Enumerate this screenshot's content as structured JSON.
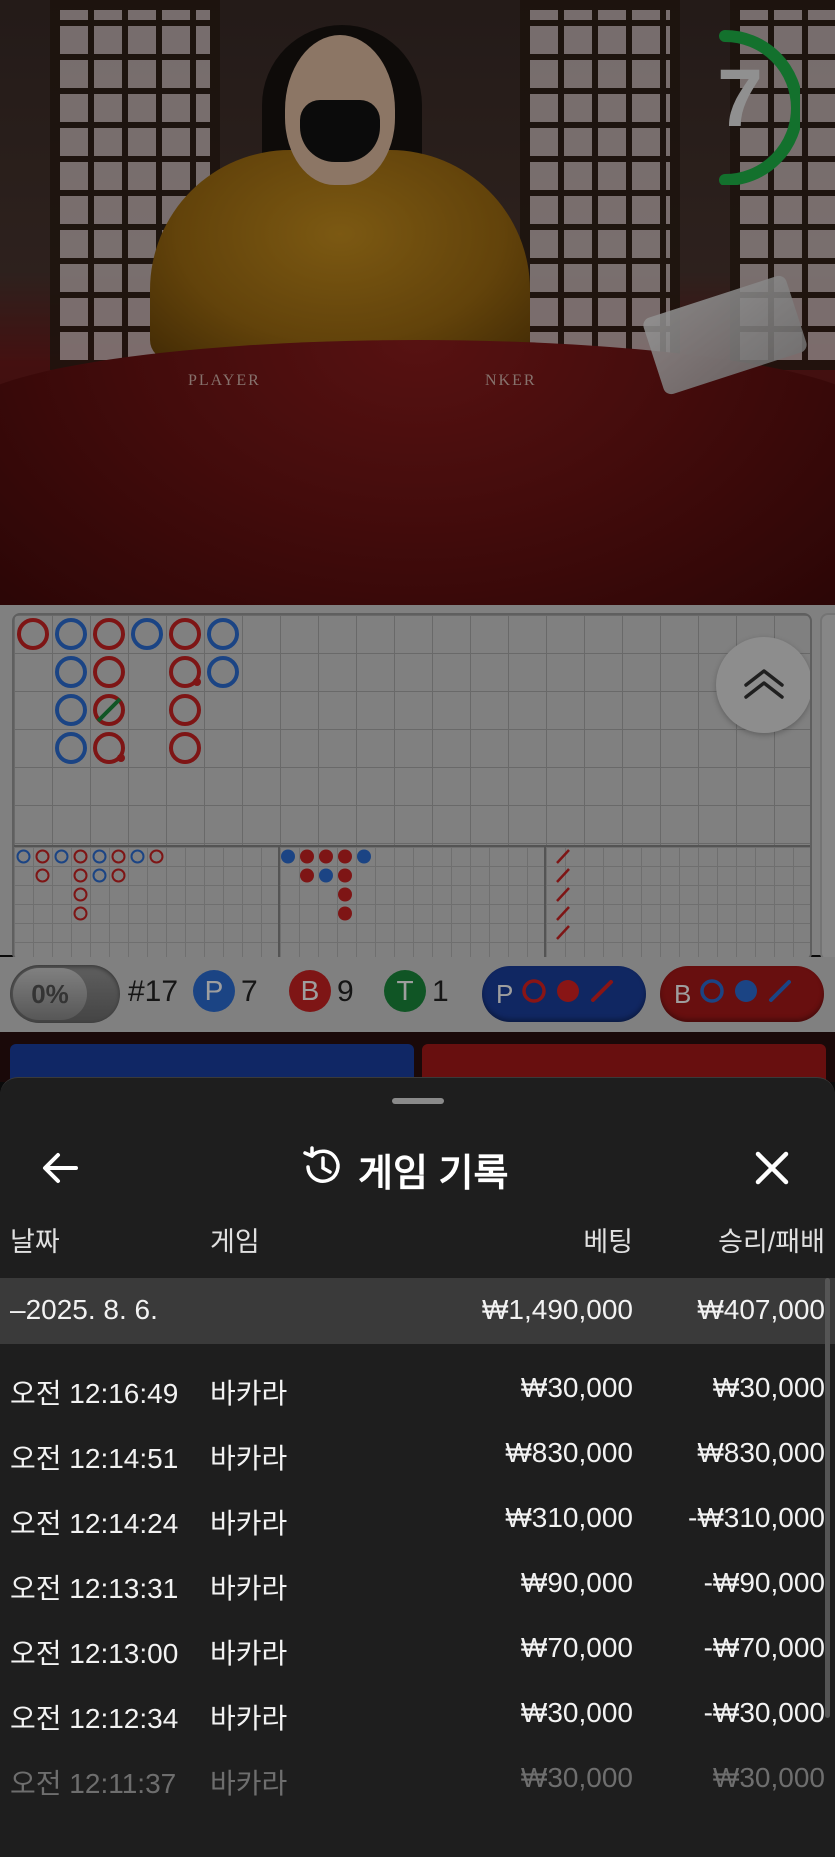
{
  "video": {
    "countdown": "7",
    "felt_left": "PLAYER",
    "felt_right": "NKER"
  },
  "roadmap": {
    "big_road": [
      {
        "col": 0,
        "row": 0,
        "c": "red"
      },
      {
        "col": 1,
        "row": 0,
        "c": "blue"
      },
      {
        "col": 1,
        "row": 1,
        "c": "blue"
      },
      {
        "col": 1,
        "row": 2,
        "c": "blue"
      },
      {
        "col": 1,
        "row": 3,
        "c": "blue"
      },
      {
        "col": 2,
        "row": 0,
        "c": "red"
      },
      {
        "col": 2,
        "row": 1,
        "c": "red"
      },
      {
        "col": 2,
        "row": 2,
        "c": "red",
        "tie": true
      },
      {
        "col": 2,
        "row": 3,
        "c": "red",
        "pair": true
      },
      {
        "col": 3,
        "row": 0,
        "c": "blue"
      },
      {
        "col": 4,
        "row": 0,
        "c": "red"
      },
      {
        "col": 4,
        "row": 1,
        "c": "red",
        "pair": true
      },
      {
        "col": 4,
        "row": 2,
        "c": "red"
      },
      {
        "col": 4,
        "row": 3,
        "c": "red"
      },
      {
        "col": 5,
        "row": 0,
        "c": "blue"
      },
      {
        "col": 5,
        "row": 1,
        "c": "blue"
      }
    ],
    "big_eye": [
      {
        "col": 0,
        "row": 0,
        "c": "blue"
      },
      {
        "col": 1,
        "row": 0,
        "c": "red"
      },
      {
        "col": 1,
        "row": 1,
        "c": "red"
      },
      {
        "col": 2,
        "row": 0,
        "c": "blue"
      },
      {
        "col": 3,
        "row": 0,
        "c": "red"
      },
      {
        "col": 3,
        "row": 1,
        "c": "red"
      },
      {
        "col": 3,
        "row": 2,
        "c": "red"
      },
      {
        "col": 3,
        "row": 3,
        "c": "red"
      },
      {
        "col": 4,
        "row": 0,
        "c": "blue"
      },
      {
        "col": 4,
        "row": 1,
        "c": "blue"
      },
      {
        "col": 5,
        "row": 0,
        "c": "red"
      },
      {
        "col": 5,
        "row": 1,
        "c": "red"
      },
      {
        "col": 6,
        "row": 0,
        "c": "blue"
      },
      {
        "col": 7,
        "row": 0,
        "c": "red"
      }
    ],
    "small": [
      {
        "col": 0,
        "row": 0,
        "c": "blue"
      },
      {
        "col": 1,
        "row": 0,
        "c": "red"
      },
      {
        "col": 1,
        "row": 1,
        "c": "red"
      },
      {
        "col": 2,
        "row": 0,
        "c": "red"
      },
      {
        "col": 2,
        "row": 1,
        "c": "blue"
      },
      {
        "col": 3,
        "row": 0,
        "c": "red"
      },
      {
        "col": 3,
        "row": 1,
        "c": "red"
      },
      {
        "col": 3,
        "row": 2,
        "c": "red"
      },
      {
        "col": 3,
        "row": 3,
        "c": "red"
      },
      {
        "col": 4,
        "row": 0,
        "c": "blue"
      }
    ],
    "cockroach": [
      {
        "col": 0,
        "row": 0
      },
      {
        "col": 0,
        "row": 1
      },
      {
        "col": 0,
        "row": 2
      },
      {
        "col": 0,
        "row": 3
      },
      {
        "col": 0,
        "row": 4
      }
    ]
  },
  "stats": {
    "percent": "0%",
    "round": "#17",
    "player_badge": "P",
    "player_count": "7",
    "banker_badge": "B",
    "banker_count": "9",
    "tie_badge": "T",
    "tie_count": "1",
    "player_predict_label": "P",
    "banker_predict_label": "B"
  },
  "colors": {
    "player": "#2c6fd6",
    "banker": "#cc2222",
    "tie": "#1a8a3c"
  },
  "history": {
    "title": "게임 기록",
    "back_icon": "back-arrow-icon",
    "history_icon": "history-clock-icon",
    "close_icon": "close-icon",
    "columns": {
      "date": "날짜",
      "game": "게임",
      "bet": "베팅",
      "result": "승리/패배"
    },
    "group": {
      "date": "–2025. 8. 6.",
      "bet": "₩1,490,000",
      "result": "₩407,000"
    },
    "rows": [
      {
        "time": "오전 12:16:49",
        "game": "바카라",
        "bet": "₩30,000",
        "result": "₩30,000"
      },
      {
        "time": "오전 12:14:51",
        "game": "바카라",
        "bet": "₩830,000",
        "result": "₩830,000"
      },
      {
        "time": "오전 12:14:24",
        "game": "바카라",
        "bet": "₩310,000",
        "result": "-₩310,000"
      },
      {
        "time": "오전 12:13:31",
        "game": "바카라",
        "bet": "₩90,000",
        "result": "-₩90,000"
      },
      {
        "time": "오전 12:13:00",
        "game": "바카라",
        "bet": "₩70,000",
        "result": "-₩70,000"
      },
      {
        "time": "오전 12:12:34",
        "game": "바카라",
        "bet": "₩30,000",
        "result": "-₩30,000"
      },
      {
        "time": "오전 12:11:37",
        "game": "바카라",
        "bet": "₩30,000",
        "result": "₩30,000"
      }
    ]
  }
}
